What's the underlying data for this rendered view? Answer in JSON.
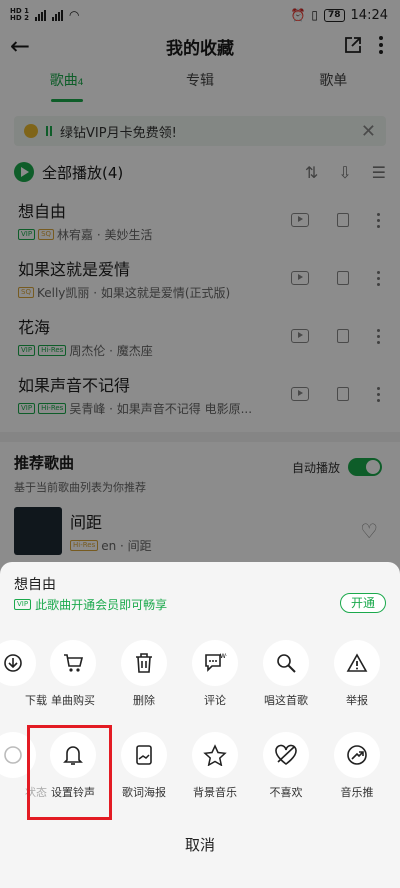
{
  "status_bar": {
    "sim1": "HD 1",
    "sim2": "HD 2",
    "battery": "78",
    "time": "14:24"
  },
  "header": {
    "title": "我的收藏"
  },
  "tabs": [
    {
      "label": "歌曲",
      "count": "4",
      "active": true
    },
    {
      "label": "专辑",
      "active": false
    },
    {
      "label": "歌单",
      "active": false
    }
  ],
  "banner": {
    "text": "绿钻VIP月卡免费领!"
  },
  "play_all": {
    "label": "全部播放(4)"
  },
  "songs": [
    {
      "name": "想自由",
      "tags": [
        "VIP",
        "SQ"
      ],
      "artist": "林宥嘉 · 美妙生活"
    },
    {
      "name": "如果这就是爱情",
      "tags": [
        "SQ"
      ],
      "artist": "Kelly凯丽 · 如果这就是爱情(正式版)"
    },
    {
      "name": "花海",
      "tags": [
        "VIP",
        "Hi-Res"
      ],
      "artist": "周杰伦 · 魔杰座"
    },
    {
      "name": "如果声音不记得",
      "tags": [
        "VIP",
        "Hi-Res"
      ],
      "artist": "吴青峰 · 如果声音不记得 电影原..."
    }
  ],
  "recommend": {
    "title": "推荐歌曲",
    "subtitle": "基于当前歌曲列表为你推荐",
    "auto_play_label": "自动播放",
    "item": {
      "name": "间距",
      "tag": "Hi-Res",
      "artist": "en · 间距"
    }
  },
  "sheet": {
    "song_title": "想自由",
    "vip_tag": "VIP",
    "vip_text": "此歌曲开通会员即可畅享",
    "open_button": "开通",
    "row1": [
      "下载",
      "单曲购买",
      "删除",
      "评论",
      "唱这首歌",
      "举报"
    ],
    "row2": [
      "状态",
      "设置铃声",
      "歌词海报",
      "背景音乐",
      "不喜欢",
      "音乐推"
    ],
    "cancel": "取消"
  },
  "colors": {
    "accent": "#1ba94c",
    "highlight": "#e31b23"
  }
}
